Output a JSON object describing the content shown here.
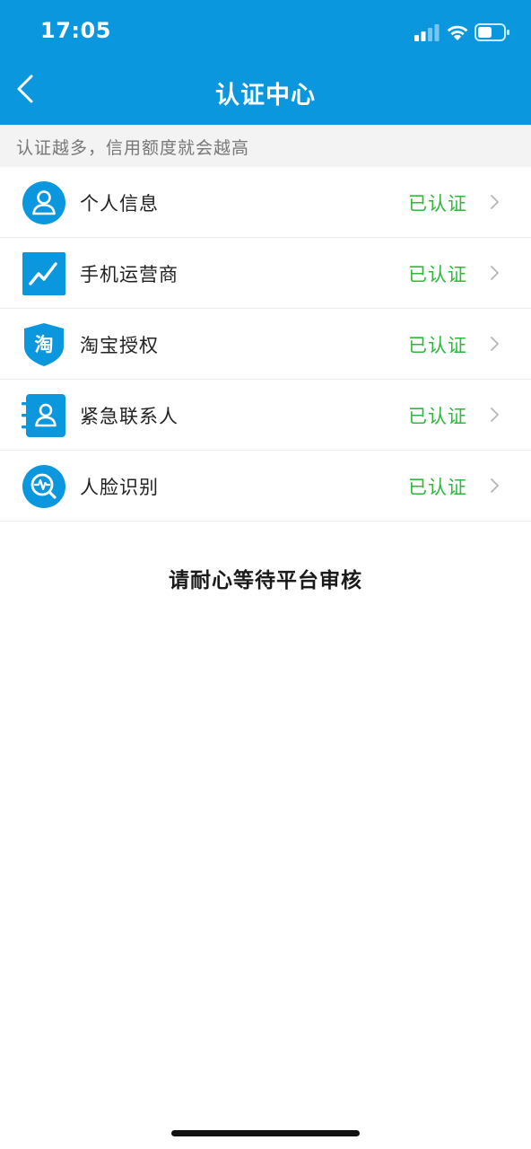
{
  "status_bar": {
    "time": "17:05",
    "icons": [
      "signal-icon",
      "wifi-icon",
      "battery-icon"
    ]
  },
  "header": {
    "title": "认证中心",
    "back_icon": "chevron-left-icon",
    "background_color": "#0a97de"
  },
  "subtitle": "认证越多，信用额度就会越高",
  "auth_items": [
    {
      "label": "个人信息",
      "status": "已认证",
      "icon": "user-icon"
    },
    {
      "label": "手机运营商",
      "status": "已认证",
      "icon": "trend-chart-icon"
    },
    {
      "label": "淘宝授权",
      "status": "已认证",
      "icon": "taobao-shield-icon",
      "icon_text": "淘"
    },
    {
      "label": "紧急联系人",
      "status": "已认证",
      "icon": "contact-book-icon"
    },
    {
      "label": "人脸识别",
      "status": "已认证",
      "icon": "face-scan-icon"
    }
  ],
  "status_color": "#2eb93c",
  "notice": "请耐心等待平台审核"
}
